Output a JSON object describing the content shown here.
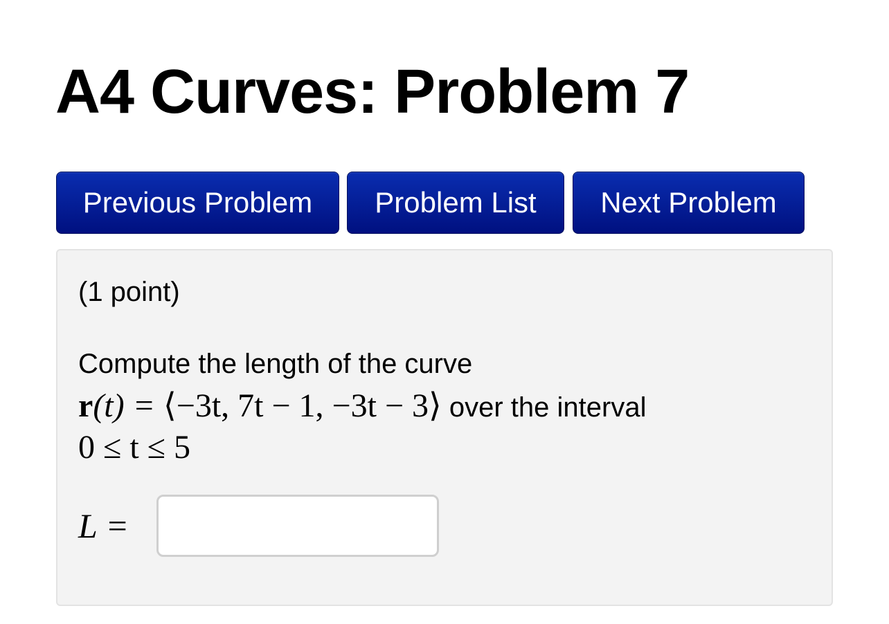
{
  "page": {
    "title": "A4 Curves: Problem 7"
  },
  "nav": {
    "previous_label": "Previous Problem",
    "list_label": "Problem List",
    "next_label": "Next Problem",
    "button_color": "#05209a"
  },
  "problem": {
    "points": "(1 point)",
    "prompt": "Compute the length of the curve",
    "formula": {
      "vector": "r",
      "lhs_arg": "(t) = ",
      "rhs": "⟨−3t, 7t − 1, −3t − 3⟩",
      "interval_text": " over the interval",
      "interval": "0 ≤ t ≤ 5"
    },
    "answer": {
      "label": "L =",
      "value": "",
      "placeholder": ""
    }
  },
  "colors": {
    "panel_background": "#f3f3f3",
    "panel_border": "#e3e3e3"
  }
}
